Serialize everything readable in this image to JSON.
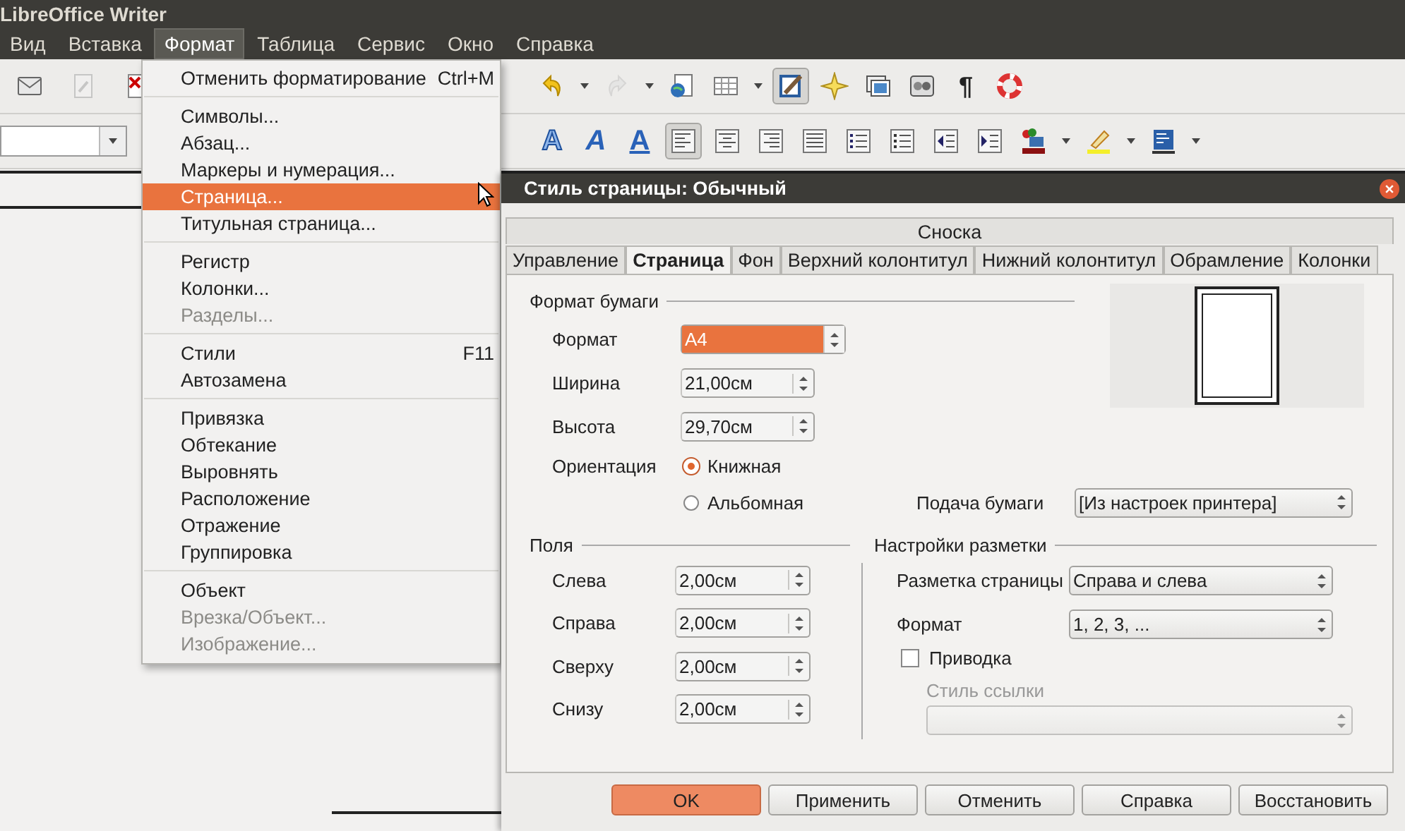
{
  "window": {
    "title": "LibreOffice Writer"
  },
  "menubar": [
    {
      "label": "Вид",
      "selected": false
    },
    {
      "label": "Вставка",
      "selected": false
    },
    {
      "label": "Формат",
      "selected": true
    },
    {
      "label": "Таблица",
      "selected": false
    },
    {
      "label": "Сервис",
      "selected": false
    },
    {
      "label": "Окно",
      "selected": false
    },
    {
      "label": "Справка",
      "selected": false
    }
  ],
  "toolbar_1": {
    "left": [
      {
        "kind": "envelope",
        "pressed": false,
        "disabled": false,
        "dropdown": false
      },
      {
        "kind": "edit",
        "pressed": false,
        "disabled": true,
        "dropdown": false
      },
      {
        "kind": "pdf",
        "pressed": false,
        "disabled": false,
        "dropdown": false
      }
    ],
    "right": [
      {
        "kind": "undo",
        "pressed": false,
        "disabled": false,
        "dropdown": true
      },
      {
        "kind": "redo",
        "pressed": false,
        "disabled": true,
        "dropdown": true
      },
      {
        "kind": "globe-page",
        "pressed": false,
        "disabled": false,
        "dropdown": false
      },
      {
        "kind": "table",
        "pressed": false,
        "disabled": false,
        "dropdown": true
      },
      {
        "kind": "draw",
        "pressed": true,
        "disabled": false,
        "dropdown": false
      },
      {
        "kind": "star",
        "pressed": false,
        "disabled": false,
        "dropdown": false
      },
      {
        "kind": "image",
        "pressed": false,
        "disabled": false,
        "dropdown": false
      },
      {
        "kind": "gallery",
        "pressed": false,
        "disabled": false,
        "dropdown": false
      },
      {
        "kind": "char",
        "label": "¶",
        "pressed": false,
        "disabled": false,
        "dropdown": false
      },
      {
        "kind": "lifebuoy",
        "pressed": false,
        "disabled": false,
        "dropdown": false
      }
    ]
  },
  "toolbar_2": {
    "right": [
      {
        "kind": "outline-text",
        "label": "A",
        "pressed": false,
        "disabled": false,
        "dropdown": false
      },
      {
        "kind": "italic-text",
        "label": "A",
        "pressed": false,
        "disabled": false,
        "dropdown": false
      },
      {
        "kind": "underline-text",
        "label": "A",
        "pressed": false,
        "disabled": false,
        "dropdown": false
      },
      {
        "kind": "align-left",
        "pressed": true,
        "disabled": false,
        "dropdown": false
      },
      {
        "kind": "align-center",
        "pressed": false,
        "disabled": false,
        "dropdown": false
      },
      {
        "kind": "align-right",
        "pressed": false,
        "disabled": false,
        "dropdown": false
      },
      {
        "kind": "justify",
        "pressed": false,
        "disabled": false,
        "dropdown": false
      },
      {
        "kind": "numbered-list",
        "pressed": false,
        "disabled": false,
        "dropdown": false
      },
      {
        "kind": "bullet-list",
        "pressed": false,
        "disabled": false,
        "dropdown": false
      },
      {
        "kind": "outdent",
        "pressed": false,
        "disabled": false,
        "dropdown": false
      },
      {
        "kind": "indent",
        "pressed": false,
        "disabled": false,
        "dropdown": false
      },
      {
        "kind": "font-color",
        "pressed": false,
        "disabled": false,
        "dropdown": true
      },
      {
        "kind": "highlight",
        "pressed": false,
        "disabled": false,
        "dropdown": true
      },
      {
        "kind": "paragraph-background",
        "pressed": false,
        "disabled": false,
        "dropdown": true
      }
    ]
  },
  "format_menu": {
    "groups": [
      [
        {
          "label": "Отменить форматирование",
          "shortcut": "Ctrl+M",
          "disabled": false,
          "selected": false
        }
      ],
      [
        {
          "label": "Символы...",
          "disabled": false,
          "selected": false
        },
        {
          "label": "Абзац...",
          "disabled": false,
          "selected": false
        },
        {
          "label": "Маркеры и нумерация...",
          "disabled": false,
          "selected": false
        },
        {
          "label": "Страница...",
          "disabled": false,
          "selected": true
        },
        {
          "label": "Титульная страница...",
          "disabled": false,
          "selected": false
        }
      ],
      [
        {
          "label": "Регистр",
          "disabled": false,
          "selected": false
        },
        {
          "label": "Колонки...",
          "disabled": false,
          "selected": false
        },
        {
          "label": "Разделы...",
          "disabled": true,
          "selected": false
        }
      ],
      [
        {
          "label": "Стили",
          "shortcut": "F11",
          "disabled": false,
          "selected": false
        },
        {
          "label": "Автозамена",
          "disabled": false,
          "selected": false
        }
      ],
      [
        {
          "label": "Привязка",
          "disabled": false,
          "selected": false
        },
        {
          "label": "Обтекание",
          "disabled": false,
          "selected": false
        },
        {
          "label": "Выровнять",
          "disabled": false,
          "selected": false
        },
        {
          "label": "Расположение",
          "disabled": false,
          "selected": false
        },
        {
          "label": "Отражение",
          "disabled": false,
          "selected": false
        },
        {
          "label": "Группировка",
          "disabled": false,
          "selected": false
        }
      ],
      [
        {
          "label": "Объект",
          "disabled": false,
          "selected": false
        },
        {
          "label": "Врезка/Объект...",
          "disabled": true,
          "selected": false
        },
        {
          "label": "Изображение...",
          "disabled": true,
          "selected": false
        }
      ]
    ]
  },
  "dialog": {
    "title": "Стиль страницы: Обычный",
    "tabs_row_1": [
      {
        "label": "Сноска",
        "selected": false
      }
    ],
    "tabs_row_2": [
      {
        "label": "Управление",
        "selected": false
      },
      {
        "label": "Страница",
        "selected": true
      },
      {
        "label": "Фон",
        "selected": false
      },
      {
        "label": "Верхний колонтитул",
        "selected": false
      },
      {
        "label": "Нижний колонтитул",
        "selected": false
      },
      {
        "label": "Обрамление",
        "selected": false
      },
      {
        "label": "Колонки",
        "selected": false
      }
    ],
    "paper_format": {
      "heading": "Формат бумаги",
      "fields": [
        {
          "kind": "combo",
          "label": "Формат",
          "value": "A4",
          "text_selected": true
        },
        {
          "kind": "spin",
          "label": "Ширина",
          "value": "21,00см",
          "text_selected": false
        },
        {
          "kind": "spin",
          "label": "Высота",
          "value": "29,70см",
          "text_selected": false
        }
      ],
      "orientation_label": "Ориентация",
      "orientations": [
        {
          "label": "Книжная",
          "selected": true
        },
        {
          "label": "Альбомная",
          "selected": false
        }
      ],
      "paper_tray_label": "Подача бумаги",
      "paper_tray_value": "[Из настроек принтера]"
    },
    "margins": {
      "heading": "Поля",
      "fields": [
        {
          "label": "Слева",
          "value": "2,00см"
        },
        {
          "label": "Справа",
          "value": "2,00см"
        },
        {
          "label": "Сверху",
          "value": "2,00см"
        },
        {
          "label": "Снизу",
          "value": "2,00см"
        }
      ]
    },
    "layout_settings": {
      "heading": "Настройки разметки",
      "page_layout_label": "Разметка страницы",
      "page_layout_value": "Справа и слева",
      "format_label": "Формат",
      "format_value": "1, 2, 3, ...",
      "register_true": {
        "label": "Приводка",
        "checked": false
      },
      "reference_style_label": "Стиль ссылки",
      "reference_style_disabled": true
    },
    "buttons": [
      {
        "label": "OK",
        "default": true
      },
      {
        "label": "Применить",
        "default": false
      },
      {
        "label": "Отменить",
        "default": false
      },
      {
        "label": "Справка",
        "default": false
      },
      {
        "label": "Восстановить",
        "default": false
      }
    ]
  }
}
